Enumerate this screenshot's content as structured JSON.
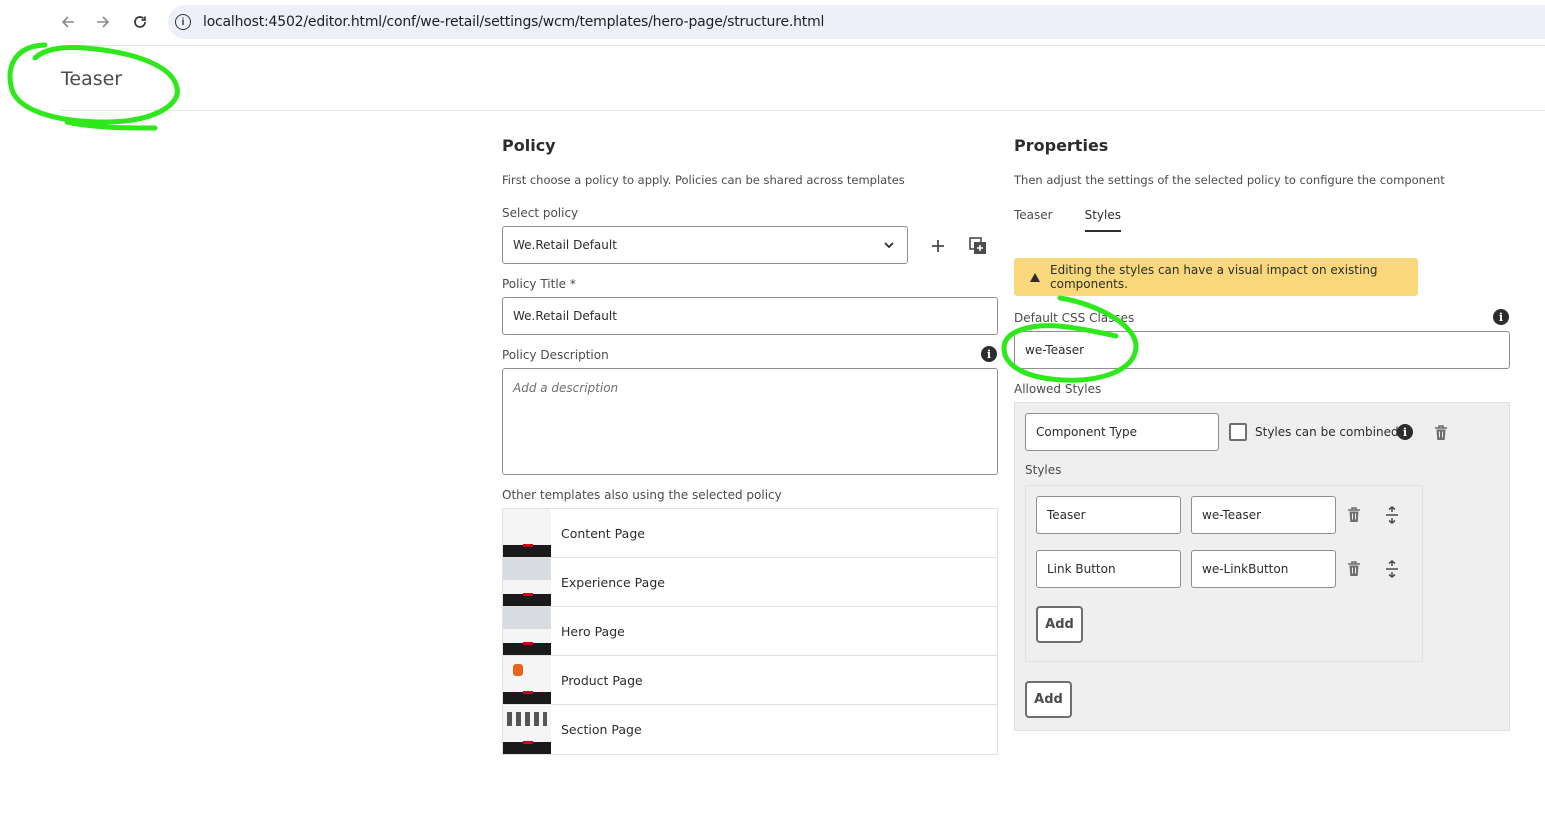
{
  "browser": {
    "url": "localhost:4502/editor.html/conf/we-retail/settings/wcm/templates/hero-page/structure.html",
    "back_icon": "arrow-left-icon",
    "forward_icon": "arrow-right-icon",
    "reload_icon": "reload-icon"
  },
  "dialog": {
    "title": "Teaser"
  },
  "policy": {
    "title": "Policy",
    "description": "First choose a policy to apply. Policies can be shared across templates",
    "select_label": "Select policy",
    "select_value": "We.Retail Default",
    "policy_title_label": "Policy Title *",
    "policy_title_value": "We.Retail Default",
    "policy_description_label": "Policy Description",
    "policy_description_placeholder": "Add a description",
    "other_templates_label": "Other templates also using the selected policy",
    "templates": [
      {
        "label": "Content Page"
      },
      {
        "label": "Experience Page"
      },
      {
        "label": "Hero Page"
      },
      {
        "label": "Product Page"
      },
      {
        "label": "Section Page"
      }
    ]
  },
  "properties": {
    "title": "Properties",
    "description": "Then adjust the settings of the selected policy to configure the component",
    "tabs": [
      {
        "label": "Teaser",
        "active": false
      },
      {
        "label": "Styles",
        "active": true
      }
    ],
    "alert_text": "Editing the styles can have a visual impact on existing components.",
    "default_css_label": "Default CSS Classes",
    "default_css_value": "we-Teaser",
    "allowed_styles_label": "Allowed Styles",
    "group_name_value": "Component Type",
    "combined_label": "Styles can be combined",
    "combined_checked": false,
    "styles_label": "Styles",
    "styles": [
      {
        "name": "Teaser",
        "class": "we-Teaser"
      },
      {
        "name": "Link Button",
        "class": "we-LinkButton"
      }
    ],
    "inner_add_label": "Add",
    "outer_add_label": "Add"
  },
  "colors": {
    "annotation": "#2ee81b",
    "alert_bg": "#f8d87a",
    "panel_bg": "#efefef"
  }
}
